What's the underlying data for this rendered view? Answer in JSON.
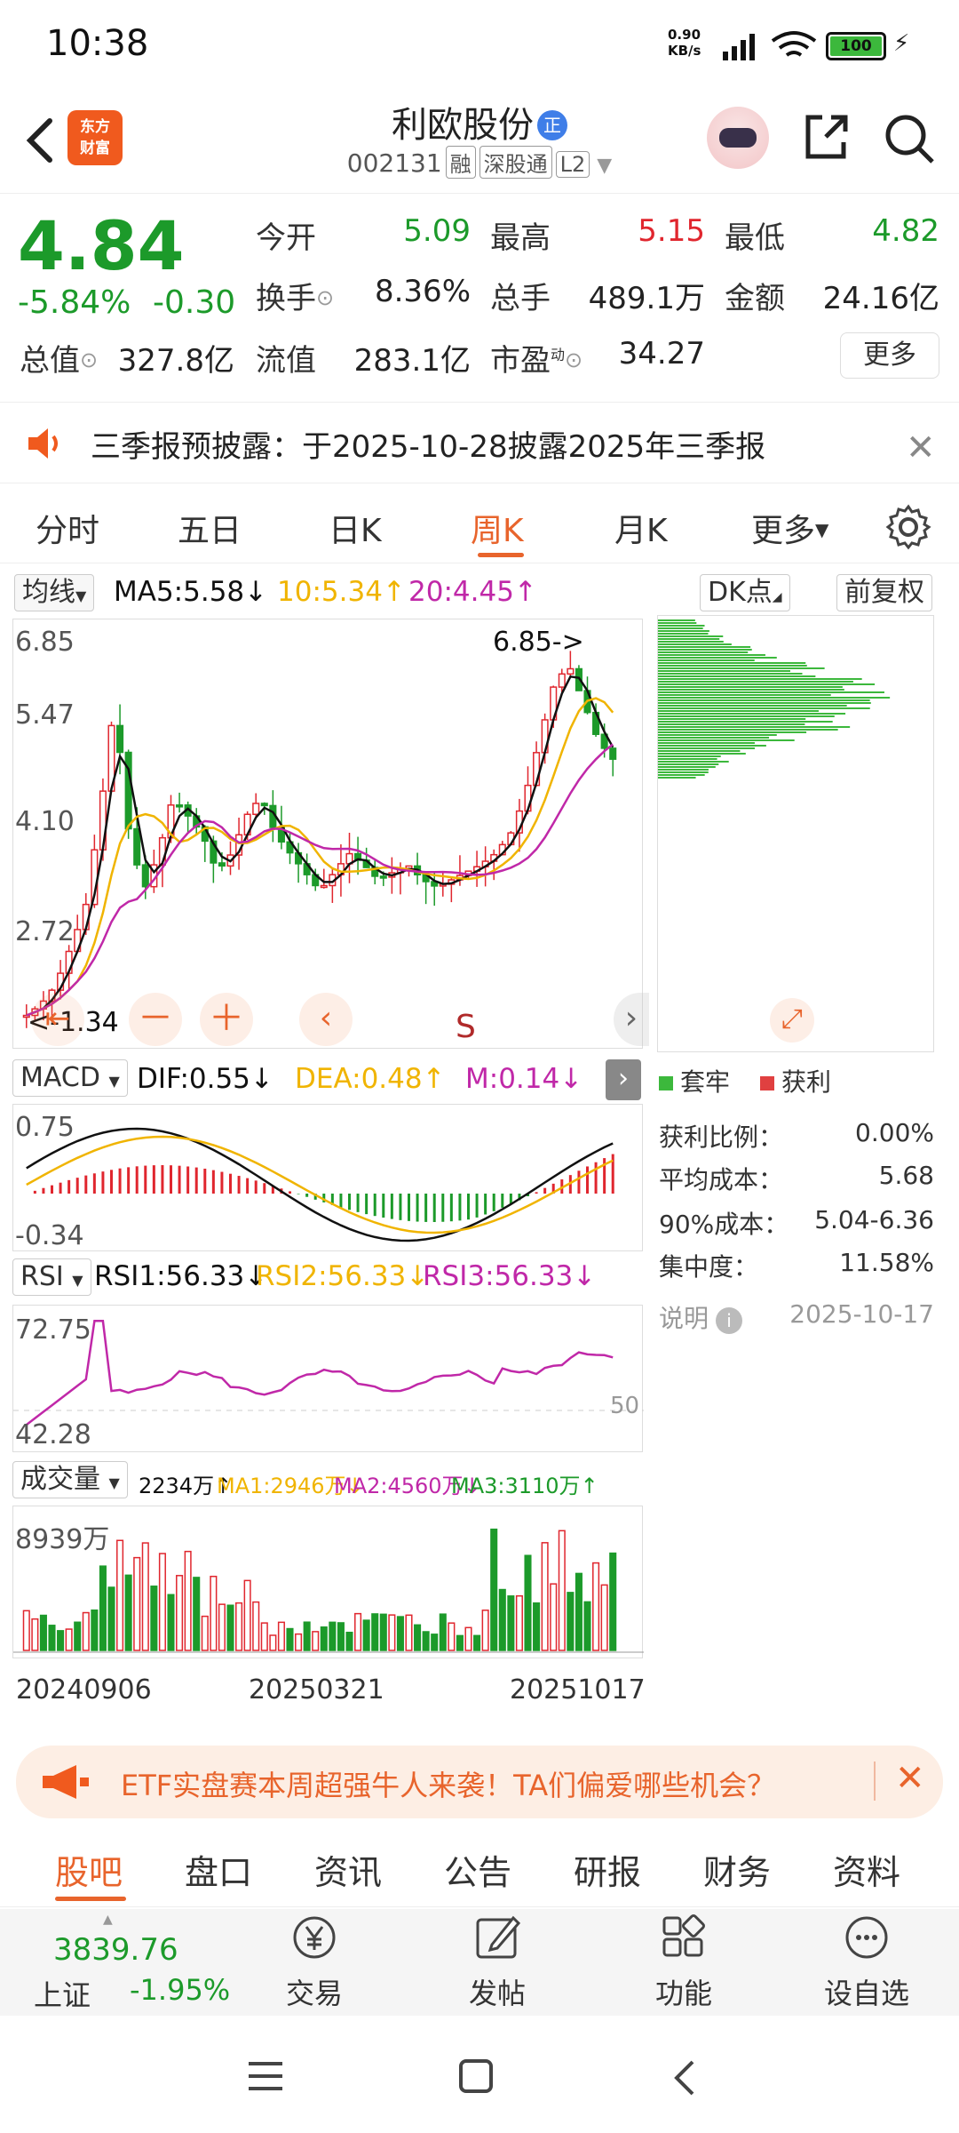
{
  "status_bar": {
    "time": "10:38",
    "net_speed": "0.90",
    "net_unit": "KB/s",
    "battery": "100"
  },
  "header": {
    "logo_text_1": "东方",
    "logo_text_2": "财富",
    "stock_name": "利欧股份",
    "name_badge": "正",
    "stock_code": "002131",
    "tags": [
      "融",
      "深股通",
      "L2"
    ]
  },
  "quote": {
    "price": "4.84",
    "change_pct": "-5.84%",
    "change_abs": "-0.30",
    "open_label": "今开",
    "open": "5.09",
    "high_label": "最高",
    "high": "5.15",
    "low_label": "最低",
    "low": "4.82",
    "turnover_label": "换手",
    "turnover": "8.36%",
    "volume_label": "总手",
    "volume": "489.1万",
    "amount_label": "金额",
    "amount": "24.16亿",
    "mktcap_label": "总值",
    "mktcap": "327.8亿",
    "float_label": "流值",
    "float": "283.1亿",
    "pe_label": "市盈",
    "pe_super": "动",
    "pe": "34.27",
    "more_label": "更多"
  },
  "notice": {
    "text": "三季报预披露：于2025-10-28披露2025年三季报"
  },
  "k_tabs": {
    "items": [
      "分时",
      "五日",
      "日K",
      "周K",
      "月K",
      "更多"
    ],
    "active": "周K"
  },
  "ma_legend": {
    "selector": "均线",
    "ma5": "MA5:5.58",
    "ma10": "10:5.34",
    "ma20": "20:4.45",
    "dk_label": "DK点",
    "adjust_label": "前复权"
  },
  "main_chart": {
    "y_labels": [
      "6.85",
      "5.47",
      "4.10",
      "2.72"
    ],
    "high_marker": "6.85->",
    "low_marker": "<-1.34",
    "s_marker": "S"
  },
  "macd": {
    "selector": "MACD",
    "dif": "DIF:0.55",
    "dea": "DEA:0.48",
    "m": "M:0.14",
    "y_top": "0.75",
    "y_bottom": "-0.34"
  },
  "rsi": {
    "selector": "RSI",
    "rsi1": "RSI1:56.33",
    "rsi2": "RSI2:56.33",
    "rsi3": "RSI3:56.33",
    "y_top": "72.75",
    "y_bottom": "42.28",
    "mid": "50"
  },
  "volume": {
    "selector": "成交量",
    "current": "2234万",
    "ma1": "MA1:2946万",
    "ma2": "MA2:4560万",
    "ma3": "MA3:3110万",
    "y_top": "8939万",
    "dates": [
      "20240906",
      "20250321",
      "20251017"
    ]
  },
  "chip_distribution": {
    "legend_trap": "套牢",
    "legend_profit": "获利",
    "stats": [
      {
        "label": "获利比例：",
        "value": "0.00%"
      },
      {
        "label": "平均成本：",
        "value": "5.68"
      },
      {
        "label": "90%成本：",
        "value": "5.04-6.36"
      },
      {
        "label": "集中度：",
        "value": "11.58%"
      }
    ],
    "note_label": "说明",
    "date": "2025-10-17"
  },
  "ad_banner": {
    "text": "ETF实盘赛本周超强牛人来袭！TA们偏爱哪些机会？"
  },
  "content_tabs": {
    "items": [
      "股吧",
      "盘口",
      "资讯",
      "公告",
      "研报",
      "财务",
      "资料"
    ],
    "active": "股吧"
  },
  "bottom_nav": {
    "index_value": "3839.76",
    "index_name": "上证",
    "index_change": "-1.95%",
    "items": [
      "交易",
      "发帖",
      "功能",
      "设自选"
    ]
  },
  "colors": {
    "up": "#e0262e",
    "down": "#1c9a2a",
    "accent": "#e8642c",
    "ma5": "#111111",
    "ma10": "#f0b400",
    "ma20": "#c028a8"
  }
}
